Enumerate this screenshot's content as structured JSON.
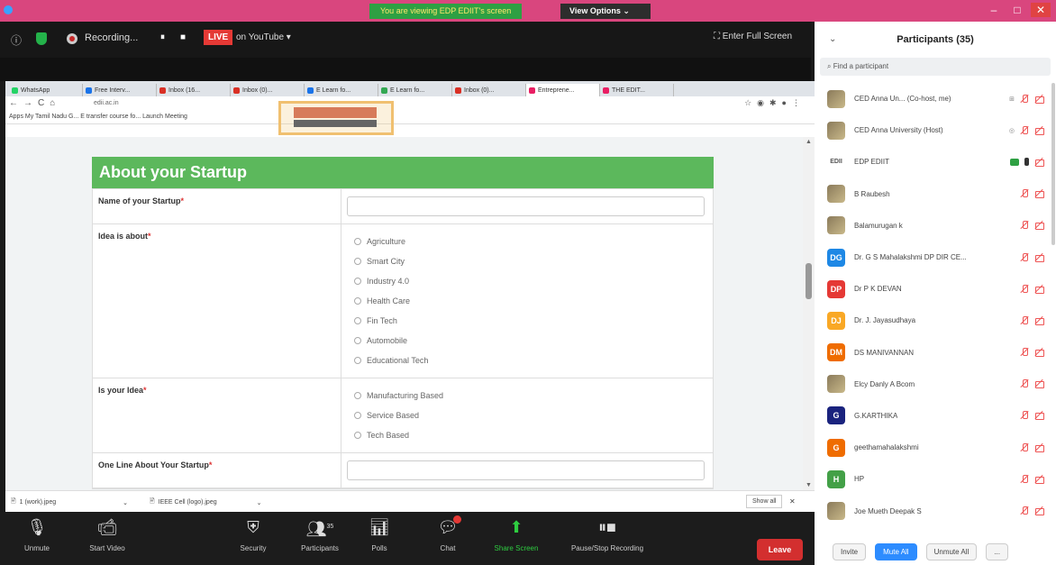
{
  "topbar": {
    "share_banner": "You are viewing EDP EDIIT's screen",
    "view_options": "View Options ⌄",
    "win_controls": [
      "–",
      "□",
      "✕"
    ]
  },
  "meeting": {
    "recording_label": "Recording...",
    "pause_label": "⏸",
    "stop_label": "■",
    "live_badge": "LIVE",
    "live_target": "on YouTube ▾",
    "fullscreen_label": "Enter Full Screen"
  },
  "browser": {
    "tabs": [
      {
        "label": "WhatsApp",
        "color": "#25d366"
      },
      {
        "label": "Free Interv...",
        "color": "#1a73e8"
      },
      {
        "label": "Inbox (16...",
        "color": "#d93025"
      },
      {
        "label": "Inbox (0)...",
        "color": "#d93025"
      },
      {
        "label": "E Learn fo...",
        "color": "#1a73e8"
      },
      {
        "label": "E Learn fo...",
        "color": "#34a853"
      },
      {
        "label": "Inbox (0)...",
        "color": "#d93025"
      },
      {
        "label": "Entreprene...",
        "color": "#e91e63"
      },
      {
        "label": "THE EDIT...",
        "color": "#e91e63"
      }
    ],
    "url": "edii.ac.in",
    "bookmarks": "Apps   My Tamil Nadu G...   E transfer course fo...   Launch Meeting"
  },
  "form": {
    "header": "About your Startup",
    "fields": [
      {
        "label": "Name of your Startup",
        "type": "text"
      },
      {
        "label": "Idea is about",
        "type": "radio",
        "options": [
          "Agriculture",
          "Smart City",
          "Industry 4.0",
          "Health Care",
          "Fin Tech",
          "Automobile",
          "Educational Tech"
        ]
      },
      {
        "label": "Is your Idea",
        "type": "radio",
        "options": [
          "Manufacturing Based",
          "Service Based",
          "Tech Based"
        ]
      },
      {
        "label": "One Line About Your Startup",
        "type": "text"
      }
    ]
  },
  "downloads": {
    "item1": "1 (work).jpeg",
    "item2": "IEEE Cell (logo).jpeg",
    "show_all": "Show all",
    "close": "✕"
  },
  "toolbar": {
    "unmute": "Unmute",
    "start_video": "Start Video",
    "security": "Security",
    "participants": "Participants",
    "participants_count": "35",
    "polls": "Polls",
    "chat": "Chat",
    "share_screen": "Share Screen",
    "pause_recording": "Pause/Stop Recording",
    "leave": "Leave"
  },
  "panel": {
    "title": "Participants (35)",
    "search_placeholder": "Find a participant",
    "participants": [
      {
        "name": "CED Anna Un... (Co-host, me)",
        "initials": "",
        "photo": true,
        "color": "#8a7a5a",
        "extra": "⊞"
      },
      {
        "name": "CED Anna University (Host)",
        "initials": "",
        "photo": true,
        "color": "#8a7a5a",
        "extra": "◎"
      },
      {
        "name": "EDP EDIIT",
        "initials": "EDII",
        "photo": false,
        "color": "#555555",
        "extra": "",
        "active": true
      },
      {
        "name": "B Raubesh",
        "initials": "",
        "photo": true,
        "color": "#5a3a2a",
        "extra": ""
      },
      {
        "name": "Balamurugan k",
        "initials": "",
        "photo": true,
        "color": "#7a5a4a",
        "extra": ""
      },
      {
        "name": "Dr. G S Mahalakshmi DP DIR CE...",
        "initials": "DG",
        "photo": false,
        "color": "#1e88e5",
        "extra": ""
      },
      {
        "name": "Dr P K DEVAN",
        "initials": "DP",
        "photo": false,
        "color": "#e53935",
        "extra": ""
      },
      {
        "name": "Dr. J. Jayasudhaya",
        "initials": "DJ",
        "photo": false,
        "color": "#f9a825",
        "extra": ""
      },
      {
        "name": "DS MANIVANNAN",
        "initials": "DM",
        "photo": false,
        "color": "#ef6c00",
        "extra": ""
      },
      {
        "name": "Elcy Danly A Bcom",
        "initials": "",
        "photo": true,
        "color": "#8a6a4a",
        "extra": ""
      },
      {
        "name": "G.KARTHIKA",
        "initials": "G",
        "photo": false,
        "color": "#1a237e",
        "extra": ""
      },
      {
        "name": "geethamahalakshmi",
        "initials": "G",
        "photo": false,
        "color": "#ef6c00",
        "extra": ""
      },
      {
        "name": "HP",
        "initials": "H",
        "photo": false,
        "color": "#43a047",
        "extra": ""
      },
      {
        "name": "Joe Mueth Deepak S",
        "initials": "",
        "photo": true,
        "color": "#6a6a5a",
        "extra": ""
      }
    ],
    "invite": "Invite",
    "mute_all": "Mute All",
    "unmute_all": "Unmute All",
    "more": "..."
  }
}
